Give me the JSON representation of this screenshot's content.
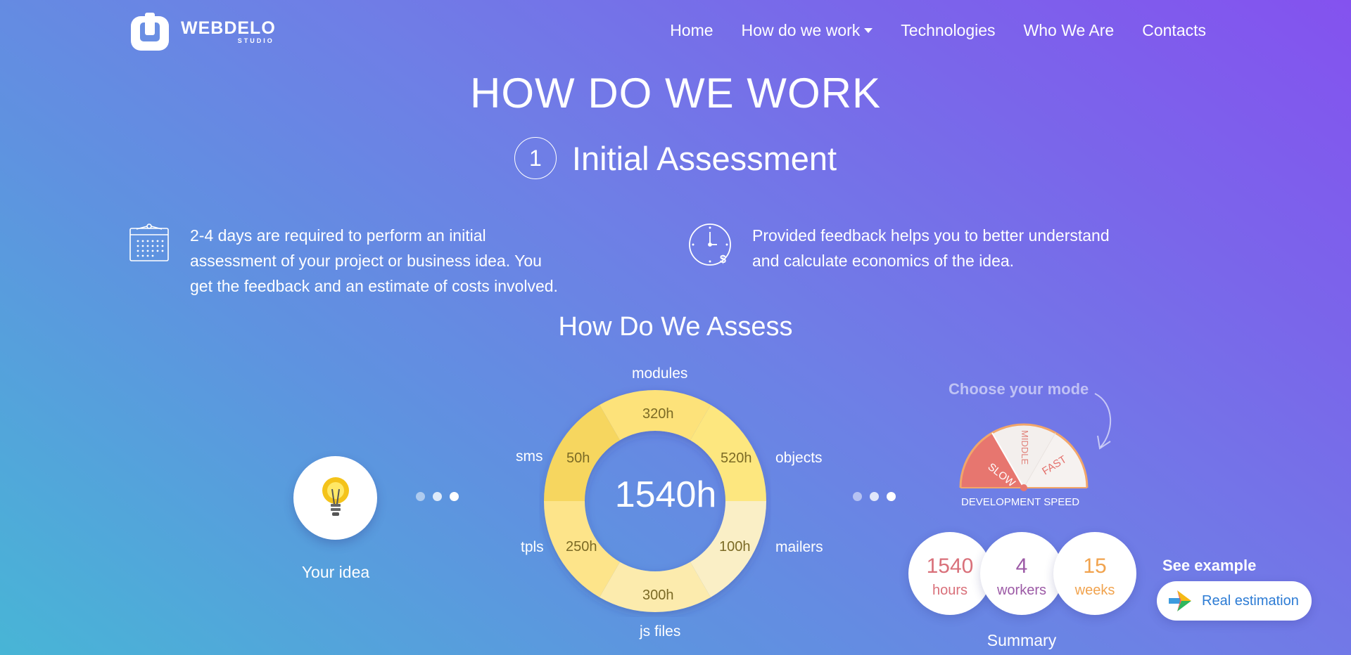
{
  "header": {
    "logo": {
      "name": "WEBDELO",
      "sub": "STUDIO"
    },
    "nav": [
      {
        "label": "Home"
      },
      {
        "label": "How do we work",
        "has_dropdown": true
      },
      {
        "label": "Technologies"
      },
      {
        "label": "Who We Are"
      },
      {
        "label": "Contacts"
      }
    ]
  },
  "page": {
    "title": "HOW DO WE WORK",
    "step_number": "1",
    "step_title": "Initial Assessment"
  },
  "info": {
    "left_lines": [
      "2-4 days are required to perform an initial",
      "assessment of your project or business idea. You",
      "get the feedback and an estimate of costs involved."
    ],
    "right_lines": [
      "Provided feedback helps you to better understand",
      "and calculate economics of the idea."
    ]
  },
  "assess": {
    "title": "How Do We Assess",
    "idea_label": "Your idea",
    "donut": {
      "total": "1540h",
      "segments": [
        {
          "name": "modules",
          "hours": "320h",
          "color": "#fde27a"
        },
        {
          "name": "objects",
          "hours": "520h",
          "color": "#fde77f"
        },
        {
          "name": "mailers",
          "hours": "100h",
          "color": "#faefc6"
        },
        {
          "name": "js files",
          "hours": "300h",
          "color": "#fcebad"
        },
        {
          "name": "tpls",
          "hours": "250h",
          "color": "#fde48a"
        },
        {
          "name": "sms",
          "hours": "50h",
          "color": "#f6d65e"
        }
      ]
    },
    "mode": {
      "choose_label": "Choose your mode",
      "caption": "DEVELOPMENT SPEED",
      "options": [
        "SLOW",
        "MIDDLE",
        "FAST"
      ],
      "active": "SLOW"
    },
    "summary": {
      "label": "Summary",
      "items": [
        {
          "value": "1540",
          "unit": "hours",
          "color": "#d9707a"
        },
        {
          "value": "4",
          "unit": "workers",
          "color": "#9c5aa6"
        },
        {
          "value": "15",
          "unit": "weeks",
          "color": "#f1a34e"
        }
      ]
    },
    "example": {
      "title": "See example",
      "button_label": "Real estimation"
    }
  }
}
